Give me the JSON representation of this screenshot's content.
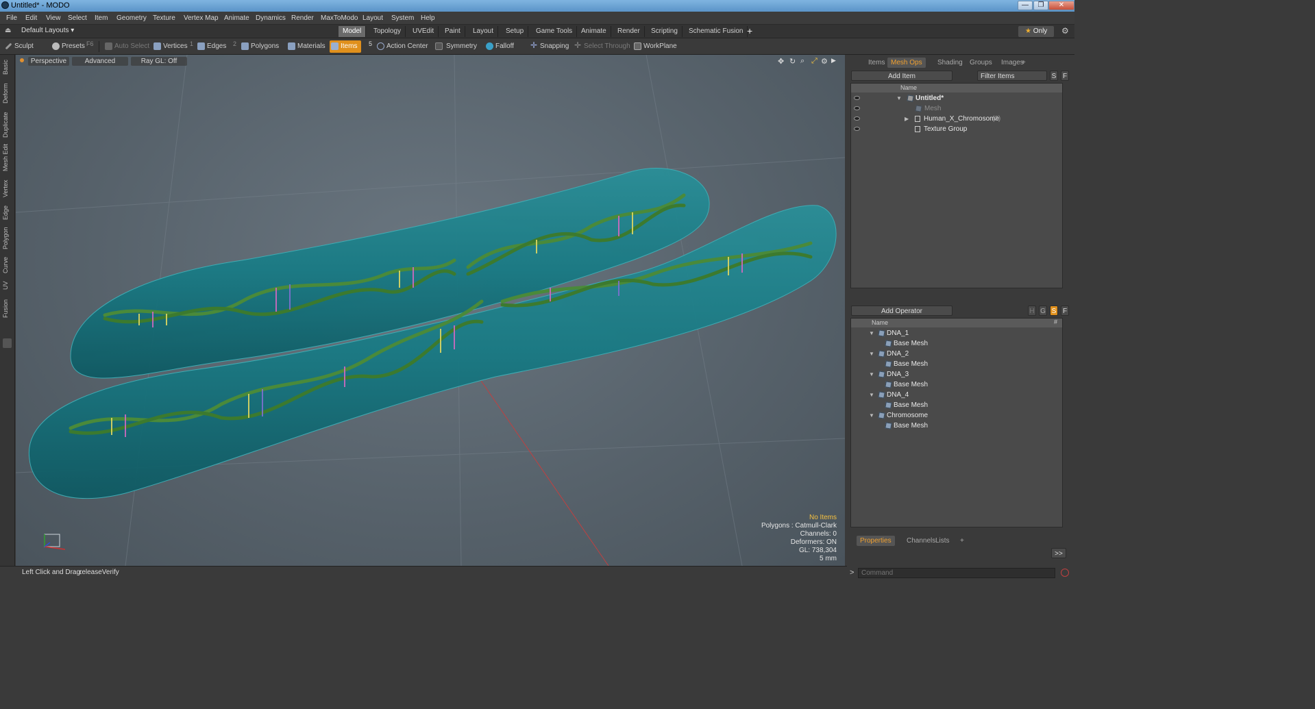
{
  "window": {
    "title": "Untitled* - MODO",
    "buttons": {
      "minimize": "—",
      "maximize": "❐",
      "close": "✕"
    }
  },
  "menubar": [
    "File",
    "Edit",
    "View",
    "Select",
    "Item",
    "Geometry",
    "Texture",
    "Vertex Map",
    "Animate",
    "Dynamics",
    "Render",
    "MaxToModo",
    "Layout",
    "System",
    "Help"
  ],
  "layout": {
    "selector": "Default Layouts",
    "tabs": [
      "Model",
      "Topology",
      "UVEdit",
      "Paint",
      "Layout",
      "Setup",
      "Game Tools",
      "Animate",
      "Render",
      "Scripting",
      "Schematic Fusion"
    ],
    "active_tab": "Model",
    "add": "+",
    "only_label": "Only",
    "star": "★"
  },
  "toolbar": {
    "sculpt": "Sculpt",
    "presets": "Presets",
    "presets_key": "F6",
    "auto_select": "Auto Select",
    "vertices": "Vertices",
    "vertices_key": "1",
    "edges": "Edges",
    "edges_key": "2",
    "polygons": "Polygons",
    "materials": "Materials",
    "items": "Items",
    "items_key": "5",
    "action_center": "Action Center",
    "symmetry": "Symmetry",
    "falloff": "Falloff",
    "snapping": "Snapping",
    "select_through": "Select Through",
    "workplane": "WorkPlane"
  },
  "left_tabs": [
    "Basic",
    "Deform",
    "Duplicate",
    "Mesh Edit",
    "Vertex",
    "Edge",
    "Polygon",
    "Curve",
    "UV",
    "Fusion"
  ],
  "viewport": {
    "view": "Perspective",
    "mode": "Advanced",
    "raygl": "Ray GL: Off",
    "stats": {
      "selection": "No Items",
      "polygons": "Polygons : Catmull-Clark",
      "channels": "Channels: 0",
      "deformers": "Deformers: ON",
      "gl": "GL: 738,304",
      "scale": "5 mm"
    }
  },
  "items_panel": {
    "tabs": [
      "Items",
      "Mesh Ops",
      "Shading",
      "Groups",
      "Images"
    ],
    "active_tab": "Mesh Ops",
    "add_item": "Add Item",
    "filter_items": "Filter Items",
    "s_btn": "S",
    "f_btn": "F",
    "column_name": "Name",
    "rows": [
      {
        "label": "Untitled*",
        "indent": 0,
        "bold": true
      },
      {
        "label": "Mesh",
        "indent": 1,
        "dim": true
      },
      {
        "label": "Human_X_Chromosome",
        "suffix": "(3)",
        "indent": 1
      },
      {
        "label": "Texture Group",
        "indent": 1
      }
    ]
  },
  "operators_panel": {
    "add_operator": "Add Operator",
    "column_name": "Name",
    "column_hash": "#",
    "btns": [
      "H",
      "G",
      "S",
      "F"
    ],
    "rows": [
      {
        "label": "DNA_1",
        "indent": 0
      },
      {
        "label": "Base Mesh",
        "indent": 1
      },
      {
        "label": "DNA_2",
        "indent": 0
      },
      {
        "label": "Base Mesh",
        "indent": 1
      },
      {
        "label": "DNA_3",
        "indent": 0
      },
      {
        "label": "Base Mesh",
        "indent": 1
      },
      {
        "label": "DNA_4",
        "indent": 0
      },
      {
        "label": "Base Mesh",
        "indent": 1
      },
      {
        "label": "Chromosome",
        "indent": 0
      },
      {
        "label": "Base Mesh",
        "indent": 1
      }
    ]
  },
  "bottom_panel": {
    "tabs": [
      "Properties",
      "Channels",
      "Lists"
    ],
    "active_tab": "Properties",
    "expand": ">>"
  },
  "statusbar": {
    "hint_label": "Left Click and Drag:",
    "hint_value": "releaseVerify"
  },
  "command": {
    "placeholder": "Command",
    "prompt": ">"
  }
}
